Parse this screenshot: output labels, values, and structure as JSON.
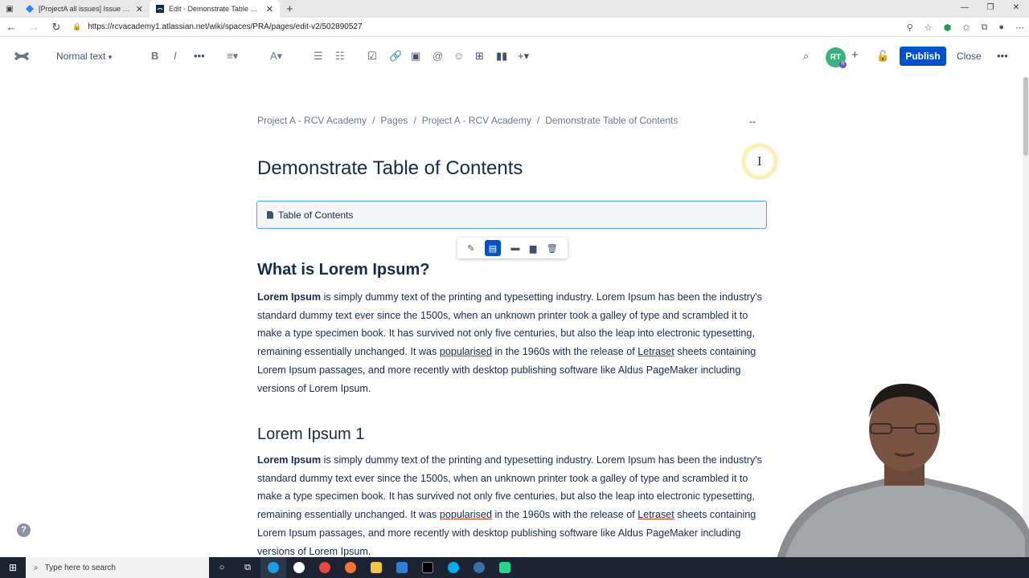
{
  "browser": {
    "tabs": [
      {
        "title": "[ProjectA all issues] Issue navigato",
        "active": false
      },
      {
        "title": "Edit - Demonstrate Table of Conte",
        "active": true
      }
    ],
    "url": "https://rcvacademy1.atlassian.net/wiki/spaces/PRA/pages/edit-v2/502890527"
  },
  "editor": {
    "text_style": "Normal text",
    "avatar_initials": "RT",
    "avatar_badge": "R",
    "publish_label": "Publish",
    "close_label": "Close",
    "accent_color": "#0052cc"
  },
  "breadcrumbs": [
    "Project A - RCV Academy",
    "Pages",
    "Project A - RCV Academy",
    "Demonstrate Table of Contents"
  ],
  "page": {
    "title": "Demonstrate Table of Contents",
    "toc_label": "Table of Contents",
    "sections": [
      {
        "heading": "What is Lorem Ipsum?",
        "lead": "Lorem Ipsum",
        "text_a": " is simply dummy text of the printing and typesetting industry. Lorem Ipsum has been the industry's standard dummy text ever since the 1500s, when an unknown printer took a galley of type and scrambled it to make a type specimen book. It has survived not only five centuries, but also the leap into electronic typesetting, remaining essentially unchanged. It was ",
        "spell1": "popularised",
        "text_b": " in the 1960s with the release of ",
        "spell2": "Letraset",
        "text_c": " sheets containing Lorem Ipsum passages, and more recently with desktop publishing software like Aldus PageMaker including versions of Lorem Ipsum."
      },
      {
        "heading": "Lorem Ipsum 1",
        "lead": "Lorem Ipsum",
        "text_a": " is simply dummy text of the printing and typesetting industry. Lorem Ipsum has been the industry's standard dummy text ever since the 1500s, when an unknown printer took a galley of type and scrambled it to make a type specimen book. It has survived not only five centuries, but also the leap into electronic typesetting, remaining essentially unchanged. It was ",
        "spell1": "popularised",
        "text_b": " in the 1960s with the release of ",
        "spell2": "Letraset",
        "text_c": " sheets containing Lorem Ipsum passages, and more recently with desktop publishing software like Aldus PageMaker including versions of Lorem Ipsum."
      }
    ]
  },
  "taskbar": {
    "search_placeholder": "Type here to search"
  }
}
